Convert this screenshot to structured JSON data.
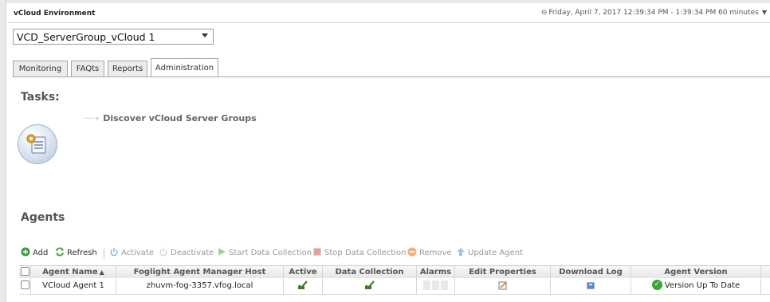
{
  "app": {
    "title": "vCloud Environment",
    "time_range": "Friday, April 7, 2017 12:39:34 PM - 1:39:34 PM 60 minutes"
  },
  "environment_select": {
    "value": "VCD_ServerGroup_vCloud 1"
  },
  "tabs": [
    {
      "label": "Monitoring",
      "active": false
    },
    {
      "label": "FAQts",
      "active": false
    },
    {
      "label": "Reports",
      "active": false
    },
    {
      "label": "Administration",
      "active": true
    }
  ],
  "tasks": {
    "title": "Tasks:",
    "link_label": "Discover vCloud Server Groups"
  },
  "agents": {
    "title": "Agents",
    "toolbar": [
      {
        "label": "Add",
        "icon": "add-icon",
        "enabled": true
      },
      {
        "label": "Refresh",
        "icon": "refresh-icon",
        "enabled": true
      },
      {
        "label": "Activate",
        "icon": "power-icon",
        "enabled": false
      },
      {
        "label": "Deactivate",
        "icon": "power-icon",
        "enabled": false
      },
      {
        "label": "Start Data Collection",
        "icon": "play-icon",
        "enabled": false
      },
      {
        "label": "Stop Data Collection",
        "icon": "stop-icon",
        "enabled": false
      },
      {
        "label": "Remove",
        "icon": "remove-icon",
        "enabled": false
      },
      {
        "label": "Update Agent",
        "icon": "update-icon",
        "enabled": false
      }
    ],
    "columns": [
      "Agent Name",
      "Foglight Agent Manager Host",
      "Active",
      "Data Collection",
      "Alarms",
      "Edit Properties",
      "Download Log",
      "Agent Version"
    ],
    "sorted_column": "Agent Name",
    "rows": [
      {
        "agent_name": "VCloud Agent 1",
        "host": "zhuvm-fog-3357.vfog.local",
        "active": true,
        "data_collection": true,
        "version_status": "Version Up To Date"
      }
    ]
  },
  "colors": {
    "accent_green": "#3aa63a",
    "disabled_text": "#999999",
    "section_title": "#555555"
  }
}
